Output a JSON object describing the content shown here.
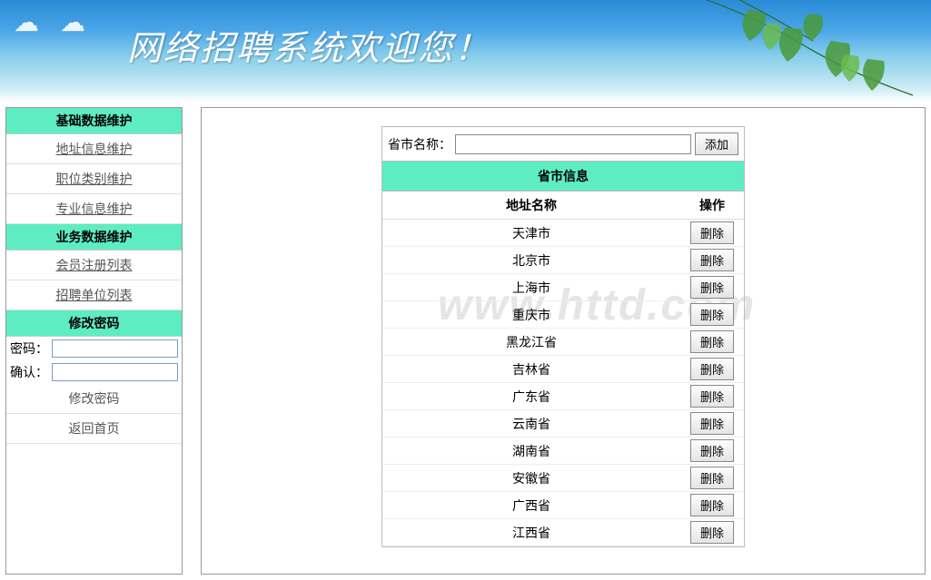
{
  "banner": {
    "title": "网络招聘系统欢迎您！"
  },
  "sidebar": {
    "section1_header": "基础数据维护",
    "links1": [
      "地址信息维护",
      "职位类别维护",
      "专业信息维护"
    ],
    "section2_header": "业务数据维护",
    "links2": [
      "会员注册列表",
      "招聘单位列表"
    ],
    "section3_header": "修改密码",
    "pw_label": "密码：",
    "confirm_label": "确认：",
    "change_pw_btn": "修改密码",
    "back_home_btn": "返回首页"
  },
  "main": {
    "form_label": "省市名称：",
    "add_btn": "添加",
    "panel_title": "省市信息",
    "col_name": "地址名称",
    "col_op": "操作",
    "delete_btn": "删除",
    "rows": [
      "天津市",
      "北京市",
      "上海市",
      "重庆市",
      "黑龙江省",
      "吉林省",
      "广东省",
      "云南省",
      "湖南省",
      "安徽省",
      "广西省",
      "江西省"
    ]
  },
  "watermark": "www.httd.com"
}
